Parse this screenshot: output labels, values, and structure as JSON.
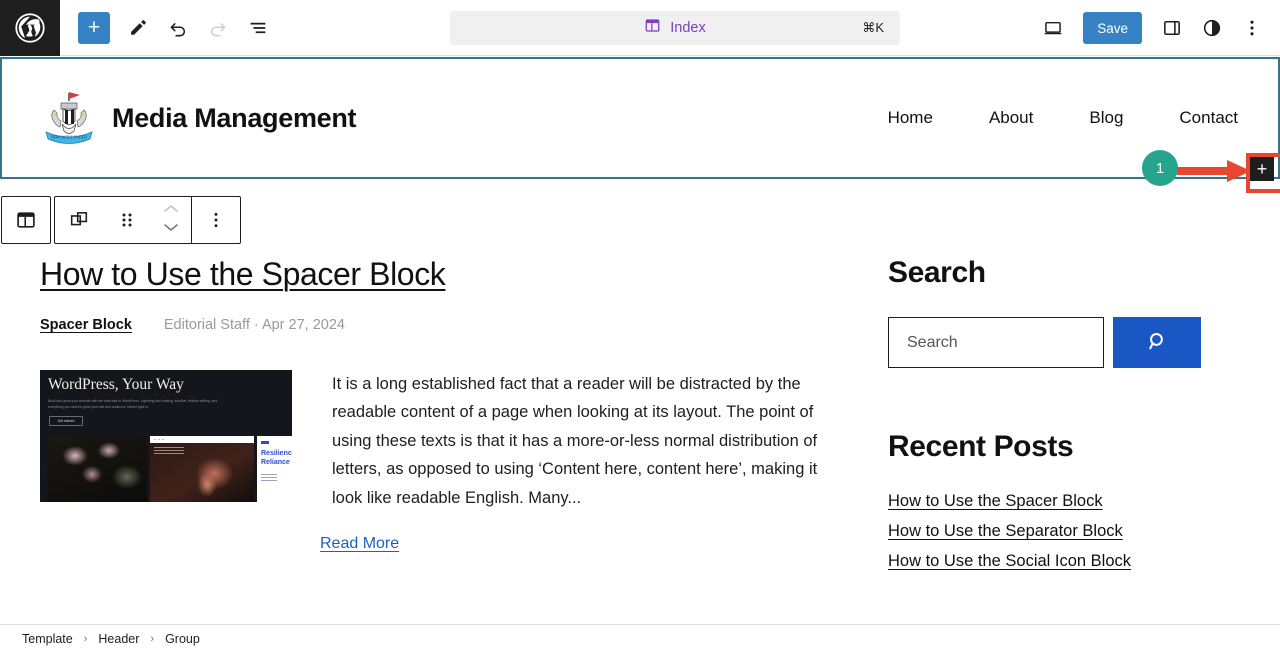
{
  "editor": {
    "logo_icon": "wordpress-logo-icon",
    "add_block_label": "+",
    "tools": [
      {
        "name": "edit-mode-icon",
        "label": "Edit"
      },
      {
        "name": "undo-icon",
        "label": "Undo"
      },
      {
        "name": "redo-icon",
        "label": "Redo"
      },
      {
        "name": "list-view-icon",
        "label": "Document Overview"
      }
    ],
    "command_bar": {
      "icon": "template-index-icon",
      "label": "Index",
      "shortcut": "⌘K"
    },
    "right_tools": [
      {
        "name": "view-desktop-icon",
        "label": "View"
      },
      {
        "name": "settings-sidebar-icon",
        "label": "Settings"
      },
      {
        "name": "styles-icon",
        "label": "Styles"
      },
      {
        "name": "options-menu-icon",
        "label": "Options"
      }
    ],
    "save_label": "Save"
  },
  "block_toolbar": {
    "buttons": [
      {
        "name": "block-type-template-icon",
        "label": "Template Part"
      },
      {
        "name": "block-type-group-icon",
        "label": "Group"
      },
      {
        "name": "drag-handle-icon",
        "label": "Drag"
      },
      {
        "name": "move-up-icon",
        "label": "Move up"
      },
      {
        "name": "move-down-icon",
        "label": "Move down"
      },
      {
        "name": "block-options-icon",
        "label": "Options"
      }
    ]
  },
  "callout": {
    "badge_number": "1",
    "arrow_color": "#e8462f",
    "badge_color": "#27a58c",
    "target_label": "+",
    "highlight_color": "#e8462f"
  },
  "site_header": {
    "logo_icon": "site-crest-logo",
    "title": "Media Management",
    "nav": [
      {
        "label": "Home"
      },
      {
        "label": "About"
      },
      {
        "label": "Blog"
      },
      {
        "label": "Contact"
      }
    ],
    "selected_border_color": "#35748f"
  },
  "post": {
    "title": "How to Use the Spacer Block",
    "category": "Spacer Block",
    "byline": "Editorial Staff · Apr 27, 2024",
    "featured_image": {
      "headline": "WordPress, Your Way",
      "subtext": "Build and grow your website with the best way to WordPress. Lightning-fast hosting, intuitive, flexible editing, and everything you need to grow your site and audience, baked right in.",
      "button_label": "Get started",
      "panel3_title": "Resilience Reliance"
    },
    "excerpt": "It is a long established fact that a reader will be distracted by the readable content of a page when looking at its layout. The point of using these texts is that it has a more-or-less normal distribution of letters, as opposed to using ‘Content here, content here’, making it look like readable English. Many...",
    "read_more_label": "Read More"
  },
  "sidebar": {
    "search_heading": "Search",
    "search_value": "",
    "search_placeholder": "Search",
    "search_button_icon": "search-icon",
    "recent_heading": "Recent Posts",
    "recent_posts": [
      {
        "label": "How to Use the Spacer Block"
      },
      {
        "label": "How to Use the Separator Block"
      },
      {
        "label": "How to Use the Social Icon Block"
      }
    ]
  },
  "breadcrumb": {
    "items": [
      {
        "label": "Template"
      },
      {
        "label": "Header"
      },
      {
        "label": "Group"
      }
    ],
    "separator": "›"
  }
}
